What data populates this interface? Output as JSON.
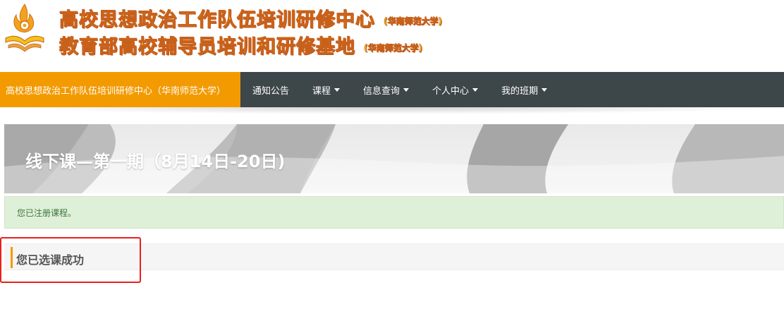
{
  "header": {
    "title_line1": "高校思想政治工作队伍培训研修中心",
    "title_line1_sub": "(华南师范大学)",
    "title_line2": "教育部高校辅导员培训和研修基地",
    "title_line2_sub": "(华南师范大学)",
    "logo_icon": "university-flame-logo-icon"
  },
  "navbar": {
    "brand": "高校思想政治工作队伍培训研修中心（华南师范大学）",
    "items": [
      {
        "label": "通知公告",
        "dropdown": false
      },
      {
        "label": "课程",
        "dropdown": true
      },
      {
        "label": "信息查询",
        "dropdown": true
      },
      {
        "label": "个人中心",
        "dropdown": true
      },
      {
        "label": "我的班期",
        "dropdown": true
      }
    ],
    "brand_color": "#f39a00",
    "bar_color": "#3d4649"
  },
  "course": {
    "title": "线下课—第一期（8月14日-20日)"
  },
  "alert": {
    "message": "您已注册课程。",
    "color": "#dff0d8"
  },
  "success": {
    "text": "您已选课成功",
    "accent_color": "#f39a00",
    "highlight_color": "#e8201c"
  }
}
